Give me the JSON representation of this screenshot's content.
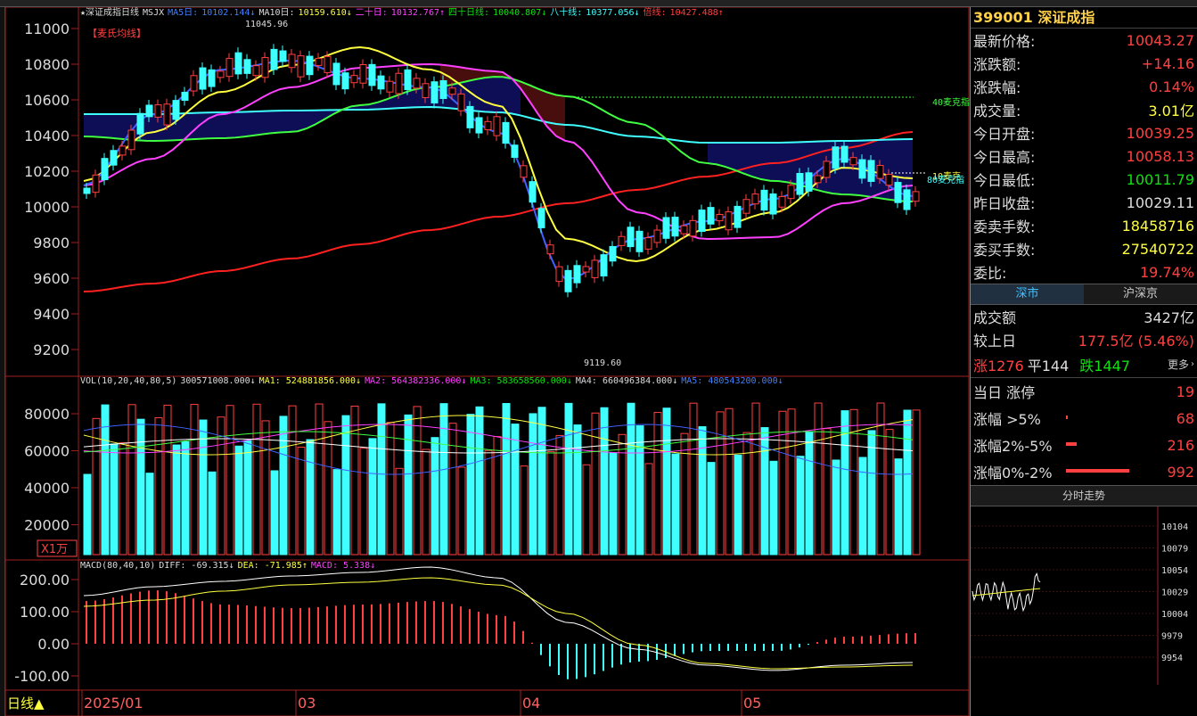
{
  "header": {
    "star": "★",
    "index_name": "深证成指",
    "period": "日线",
    "indicator": "MSJX",
    "ma5_label": "MA5日:",
    "ma5_value": "10102.144↓",
    "ma10_label": "MA10日:",
    "ma10_value": "10159.610↓",
    "ma20_label": "二十日:",
    "ma20_value": "10132.767↑",
    "ma40_label": "四十日线:",
    "ma40_value": "10040.807↓",
    "ma80_label": "八十线:",
    "ma80_value": "10377.056↓",
    "double_label": "倍线:",
    "double_value": "10427.488↑",
    "tag": "【麦氏均线】"
  },
  "price_chart": {
    "y_ticks": [
      "11000",
      "10800",
      "10600",
      "10400",
      "10200",
      "10000",
      "9800",
      "9600",
      "9400",
      "9200"
    ],
    "y_tick_values": [
      11000,
      10800,
      10600,
      10400,
      10200,
      10000,
      9800,
      9600,
      9400,
      9200
    ],
    "high_label": "11045.96",
    "low_label": "9119.60",
    "right_label_1": "40麦克指",
    "right_label_2": "10麦克",
    "right_label_3": "80麦克指"
  },
  "volume_chart": {
    "legend_title": "VOL(10,20,40,80,5)",
    "vol_value": "300571008.000↓",
    "ma1": "MA1: 524881856.000↓",
    "ma2": "MA2: 564382336.000↓",
    "ma3": "MA3: 583658560.000↓",
    "ma4": "MA4: 660496384.000↓",
    "ma5": "MA5: 480543200.000↓",
    "y_ticks": [
      "80000",
      "60000",
      "40000",
      "20000"
    ],
    "unit": "X1万"
  },
  "macd_chart": {
    "legend_title": "MACD(80,40,10)",
    "diff": "DIFF: -69.315↓",
    "dea": "DEA: -71.985↑",
    "macd": "MACD: 5.338↓",
    "y_ticks": [
      "200.00",
      "100.00",
      "0.00",
      "-100.00"
    ]
  },
  "x_axis": {
    "period_button": "日线▲",
    "labels": [
      "2025/01",
      "03",
      "04",
      "05"
    ]
  },
  "right_panel": {
    "code": "399001",
    "name": "深证成指",
    "rows": [
      {
        "label": "最新价格:",
        "value": "10043.27",
        "color": "red"
      },
      {
        "label": "涨跌额:",
        "value": "+14.16",
        "color": "red"
      },
      {
        "label": "涨跌幅:",
        "value": "0.14%",
        "color": "red"
      },
      {
        "label": "成交量:",
        "value": "3.01亿",
        "color": "yellow"
      },
      {
        "label": "今日开盘:",
        "value": "10039.25",
        "color": "red"
      },
      {
        "label": "今日最高:",
        "value": "10058.13",
        "color": "red"
      },
      {
        "label": "今日最低:",
        "value": "10011.79",
        "color": "green"
      },
      {
        "label": "昨日收盘:",
        "value": "10029.11",
        "color": "white"
      },
      {
        "label": "委卖手数:",
        "value": "18458716",
        "color": "yellow"
      },
      {
        "label": "委买手数:",
        "value": "27540722",
        "color": "yellow"
      },
      {
        "label": "委比:",
        "value": "19.74%",
        "color": "red"
      }
    ],
    "tabs": [
      "深市",
      "沪深京"
    ],
    "turnover_label": "成交额",
    "turnover_value": "3427亿",
    "compare_label": "较上日",
    "compare_value": "177.5亿 (5.46%)",
    "up_label": "涨1276",
    "flat_label": "平144",
    "down_label": "跌1447",
    "more_label": "更多",
    "limit_rows": [
      {
        "label": "当日 涨停",
        "value": "19",
        "fraction": 0
      },
      {
        "label": "涨幅 >5%",
        "value": "68",
        "fraction": 0.02
      },
      {
        "label": "涨幅2%-5%",
        "value": "216",
        "fraction": 0.12
      },
      {
        "label": "涨幅0%-2%",
        "value": "992",
        "fraction": 0.68
      }
    ],
    "intraday_title": "分时走势",
    "intraday_ticks": [
      "10104",
      "10079",
      "10054",
      "10029",
      "10004",
      "9979",
      "9954"
    ]
  },
  "colors": {
    "up": "#ff4040",
    "down": "#40ffff",
    "ma5": "#ffffff",
    "ma10": "#ffff40",
    "ma20": "#ff40ff",
    "ma40": "#40ff40",
    "ma80": "#40ffff",
    "double": "#ff2020"
  }
}
